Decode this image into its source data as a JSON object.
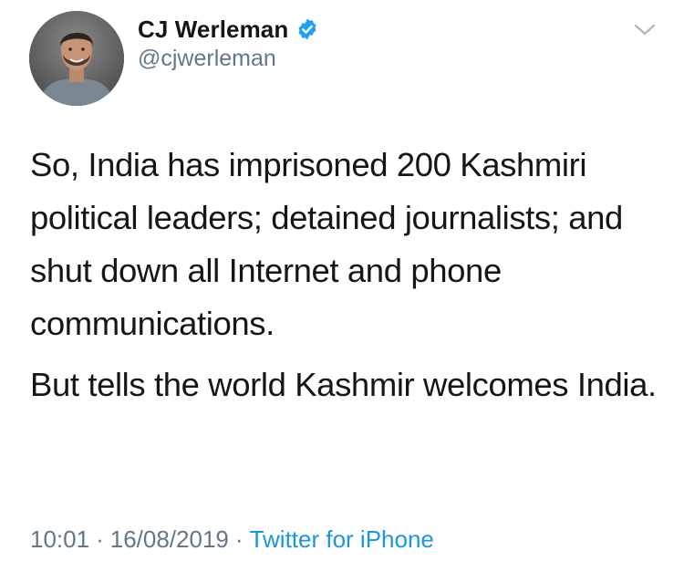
{
  "author": {
    "display_name": "CJ Werleman",
    "handle": "@cjwerleman",
    "verified": true,
    "avatar_icon": "profile-photo"
  },
  "tweet": {
    "paragraphs": [
      "So, India has imprisoned 200 Kashmiri political leaders; detained journalists; and shut down all Internet and phone communications.",
      "But tells the world Kashmir welcomes India."
    ]
  },
  "meta": {
    "time": "10:01",
    "date": "16/08/2019",
    "separator": "·",
    "source": "Twitter for iPhone"
  },
  "menu_icon": "chevron-down-icon",
  "colors": {
    "text": "#14171a",
    "secondary": "#657786",
    "link": "#1b95e0",
    "verified_badge": "#1da1f2"
  }
}
